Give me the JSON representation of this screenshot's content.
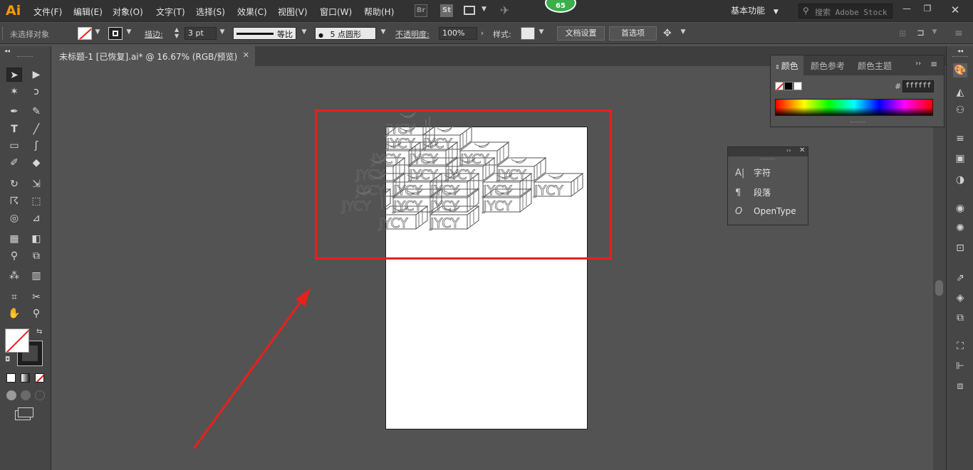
{
  "app": {
    "logo": "Ai"
  },
  "menubar": {
    "items": [
      "文件(F)",
      "编辑(E)",
      "对象(O)",
      "文字(T)",
      "选择(S)",
      "效果(C)",
      "视图(V)",
      "窗口(W)",
      "帮助(H)"
    ],
    "bridge_label": "Br",
    "stock_label": "St",
    "notification_count": "65",
    "workspace": "基本功能",
    "search_placeholder": "搜索 Adobe Stock"
  },
  "control": {
    "selection_status": "未选择对象",
    "stroke_label": "描边:",
    "stroke_weight": "3 pt",
    "profile_label": "等比",
    "brush_label": "5 点圆形",
    "opacity_label": "不透明度:",
    "opacity_value": "100%",
    "style_label": "样式:",
    "doc_setup": "文档设置",
    "preferences": "首选项"
  },
  "document": {
    "tab_title": "未标题-1 [已恢复].ai* @ 16.67% (RGB/预览)"
  },
  "artwork": {
    "text": "JYCY"
  },
  "color_panel": {
    "tabs": [
      "颜色",
      "颜色参考",
      "颜色主题"
    ],
    "hash": "#",
    "hex_value": "ffffff"
  },
  "type_panel": {
    "items": [
      {
        "icon": "character-icon",
        "label": "字符"
      },
      {
        "icon": "paragraph-icon",
        "label": "段落"
      },
      {
        "icon": "opentype-icon",
        "label": "OpenType"
      }
    ]
  },
  "annotation": {
    "highlight_color": "#e8201c",
    "arrow_color": "#e8201c"
  }
}
